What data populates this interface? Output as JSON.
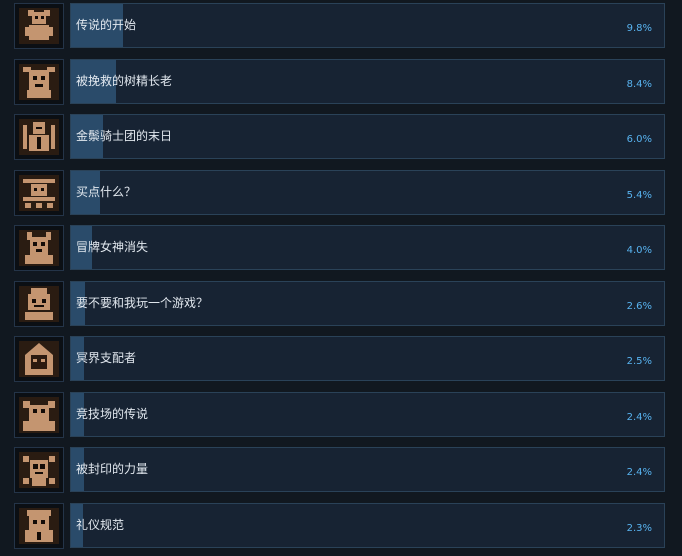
{
  "achievements": [
    {
      "title": "传说的开始",
      "percent_label": "9.8%",
      "percent": 9.8,
      "icon": "jester-icon"
    },
    {
      "title": "被挽救的树精长老",
      "percent_label": "8.4%",
      "percent": 8.4,
      "icon": "tree-elder-icon"
    },
    {
      "title": "金鬃骑士团的末日",
      "percent_label": "6.0%",
      "percent": 6.0,
      "icon": "knight-order-icon"
    },
    {
      "title": "买点什么？",
      "percent_label": "5.4%",
      "percent": 5.4,
      "icon": "merchant-icon"
    },
    {
      "title": "冒牌女神消失",
      "percent_label": "4.0%",
      "percent": 4.0,
      "icon": "false-goddess-icon"
    },
    {
      "title": "要不要和我玩一个游戏？",
      "percent_label": "2.6%",
      "percent": 2.6,
      "icon": "gamemaster-icon"
    },
    {
      "title": "冥界支配者",
      "percent_label": "2.5%",
      "percent": 2.5,
      "icon": "hooded-ruler-icon"
    },
    {
      "title": "竞技场的传说",
      "percent_label": "2.4%",
      "percent": 2.4,
      "icon": "arena-icon"
    },
    {
      "title": "被封印的力量",
      "percent_label": "2.4%",
      "percent": 2.4,
      "icon": "sealed-skull-icon"
    },
    {
      "title": "礼仪规范",
      "percent_label": "2.3%",
      "percent": 2.3,
      "icon": "etiquette-icon"
    }
  ],
  "colors": {
    "page_bg": "#111820",
    "bar_bg": "#172333",
    "bar_fill": "#2a4b6a",
    "percent_text": "#58b3f0",
    "title_text": "#e2e8ef",
    "icon_art": "#c49570"
  }
}
